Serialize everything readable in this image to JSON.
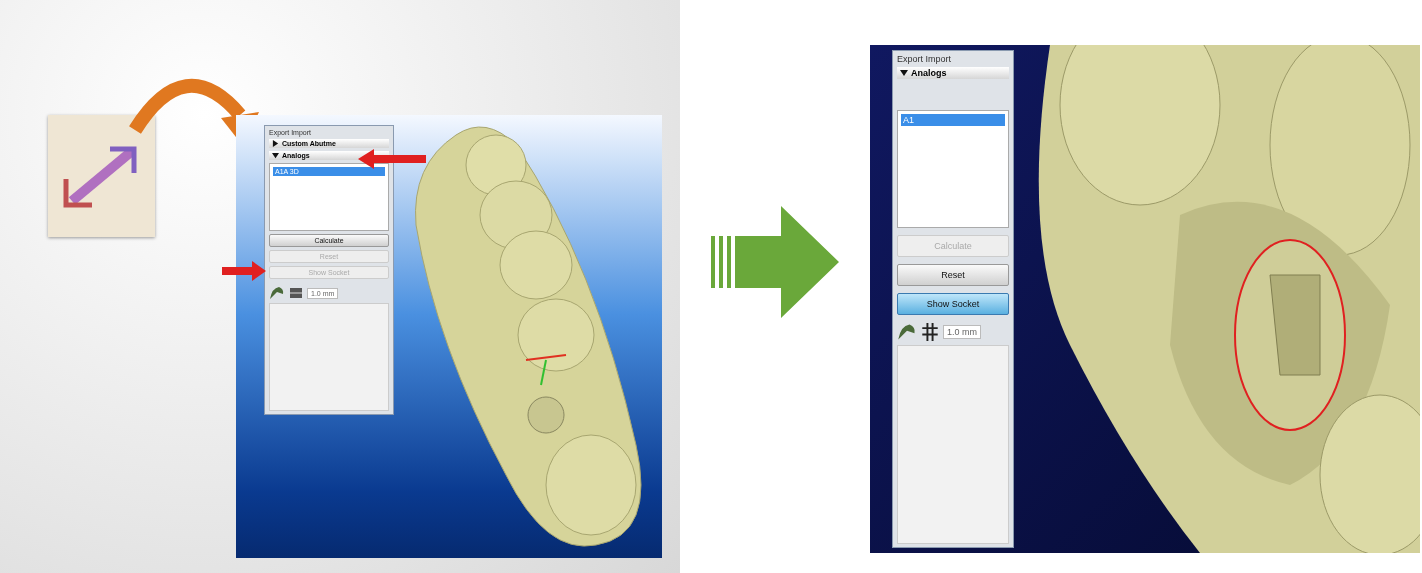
{
  "left_screenshot": {
    "panel": {
      "title": "Export Import",
      "sections": [
        {
          "label": "Custom Abutme",
          "expanded": false
        },
        {
          "label": "Analogs",
          "expanded": true
        }
      ],
      "list_items": [
        {
          "label": "A1A 3D",
          "selected": true
        }
      ],
      "buttons": [
        {
          "label": "Calculate",
          "disabled": false,
          "active": false
        },
        {
          "label": "Reset",
          "disabled": true,
          "active": false
        },
        {
          "label": "Show Socket",
          "disabled": true,
          "active": false
        }
      ],
      "offset_value": "1.0 mm"
    }
  },
  "right_screenshot": {
    "panel": {
      "title": "Export Import",
      "sections": [
        {
          "label": "Analogs",
          "expanded": true
        }
      ],
      "list_items": [
        {
          "label": "A1",
          "selected": true
        }
      ],
      "buttons": [
        {
          "label": "Calculate",
          "disabled": true,
          "active": false
        },
        {
          "label": "Reset",
          "disabled": false,
          "active": false
        },
        {
          "label": "Show Socket",
          "disabled": false,
          "active": true
        }
      ],
      "offset_value": "1.0 mm"
    }
  }
}
